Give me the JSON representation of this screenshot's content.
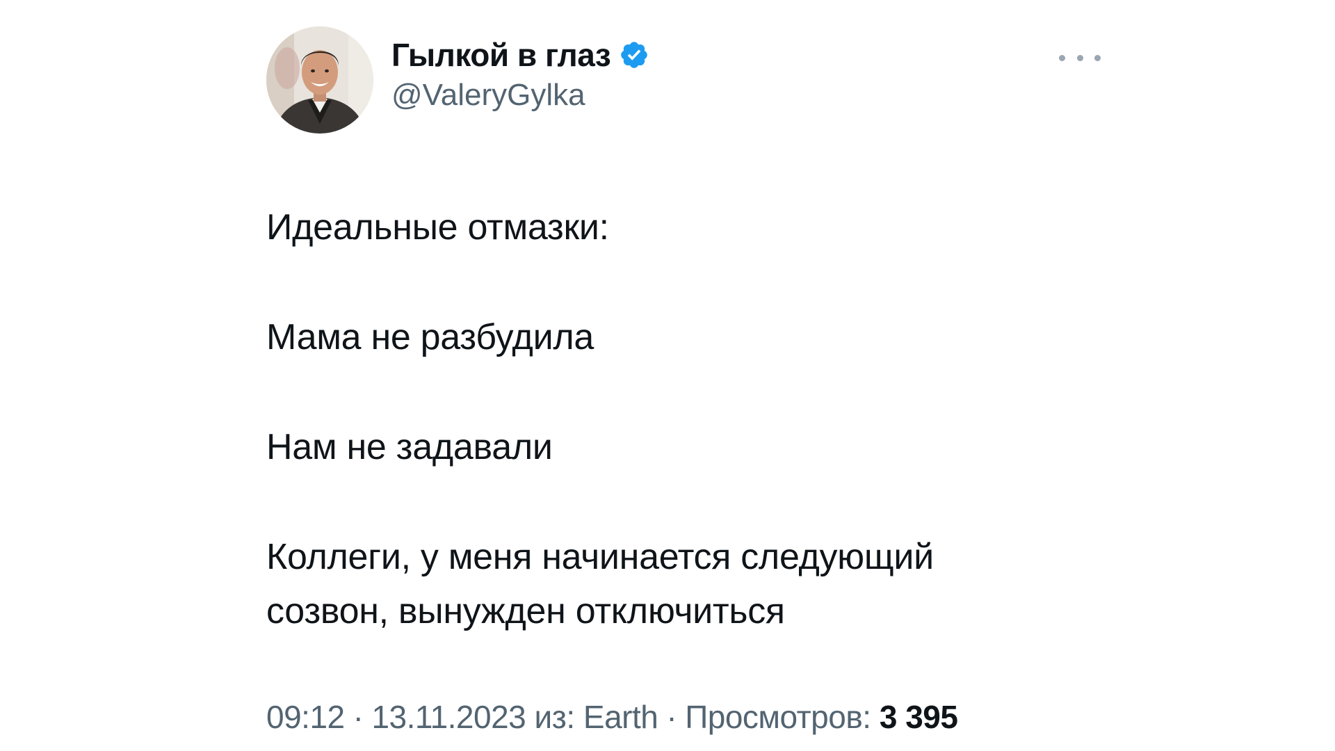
{
  "author": {
    "display_name": "Гылкой в глаз",
    "handle": "@ValeryGylka",
    "verified_icon": "verified-badge-icon",
    "avatar": "profile-photo"
  },
  "menu": {
    "icon": "more-options-icon"
  },
  "tweet": {
    "paragraphs": [
      "Идеальные отмазки:",
      "Мама не разбудила",
      "Нам не задавали",
      "Коллеги, у меня начинается следующий созвон, вынужден отключиться"
    ]
  },
  "meta": {
    "time": "09:12",
    "separator": "·",
    "date": "13.11.2023",
    "source_prefix": "из:",
    "source": "Earth",
    "views_label": "Просмотров:",
    "views_count": "3 395"
  },
  "colors": {
    "text": "#0f1419",
    "secondary": "#536471",
    "verified": "#1d9bf0",
    "background": "#ffffff"
  }
}
